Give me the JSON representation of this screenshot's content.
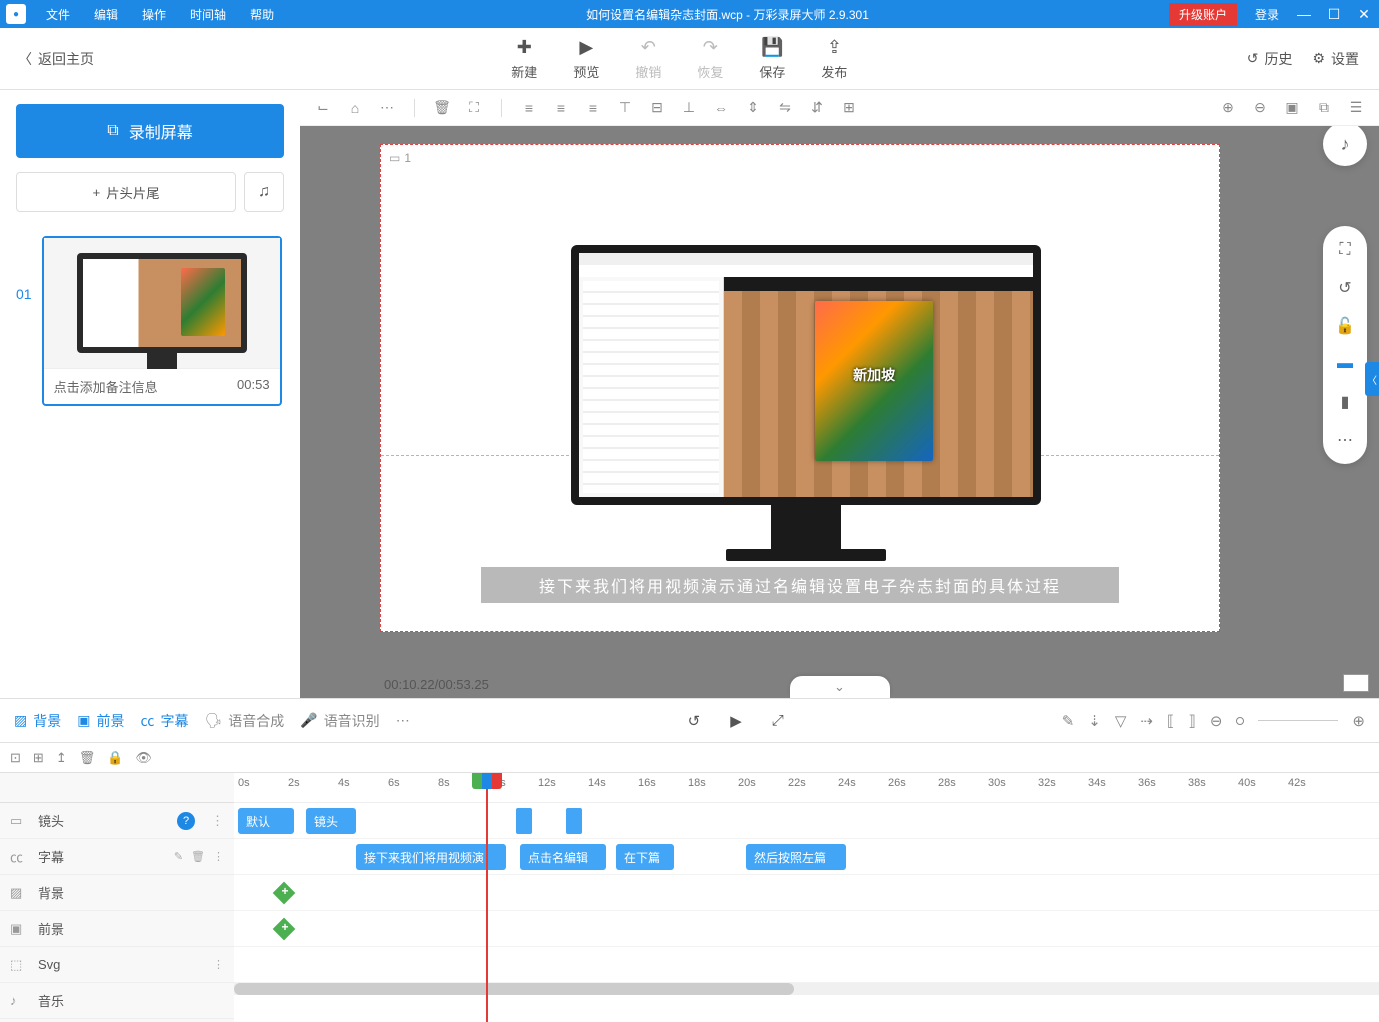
{
  "titlebar": {
    "menus": [
      "文件",
      "编辑",
      "操作",
      "时间轴",
      "帮助"
    ],
    "title": "如何设置名编辑杂志封面.wcp - 万彩录屏大师 2.9.301",
    "upgrade": "升级账户",
    "login": "登录"
  },
  "toolbar": {
    "back": "返回主页",
    "new": "新建",
    "preview": "预览",
    "undo": "撤销",
    "redo": "恢复",
    "save": "保存",
    "publish": "发布",
    "history": "历史",
    "settings": "设置"
  },
  "left": {
    "record": "录制屏幕",
    "headtail": "片头片尾",
    "scene_num": "01",
    "scene_note": "点击添加备注信息",
    "scene_duration": "00:53"
  },
  "canvas": {
    "cam_index": "1",
    "subtitle": "接下来我们将用视频演示通过名编辑设置电子杂志封面的具体过程",
    "mag_title": "新加坡",
    "time_readout": "00:10.22/00:53.25"
  },
  "timeline_tabs": {
    "bg": "背景",
    "fg": "前景",
    "subtitle": "字幕",
    "tts": "语音合成",
    "asr": "语音识别"
  },
  "ruler": [
    "0s",
    "2s",
    "4s",
    "6s",
    "8s",
    "10s",
    "12s",
    "14s",
    "16s",
    "18s",
    "20s",
    "22s",
    "24s",
    "26s",
    "28s",
    "30s",
    "32s",
    "34s",
    "36s",
    "38s",
    "40s",
    "42s"
  ],
  "tracks": {
    "camera": "镜头",
    "subtitle": "字幕",
    "bg": "背景",
    "fg": "前景",
    "svg": "Svg",
    "audio": "音乐"
  },
  "clips": {
    "default": "默认",
    "camera": "镜头",
    "sub1": "接下来我们将用视频演",
    "sub2": "点击名编辑",
    "sub3": "在下篇",
    "sub4": "然后按照左篇"
  }
}
